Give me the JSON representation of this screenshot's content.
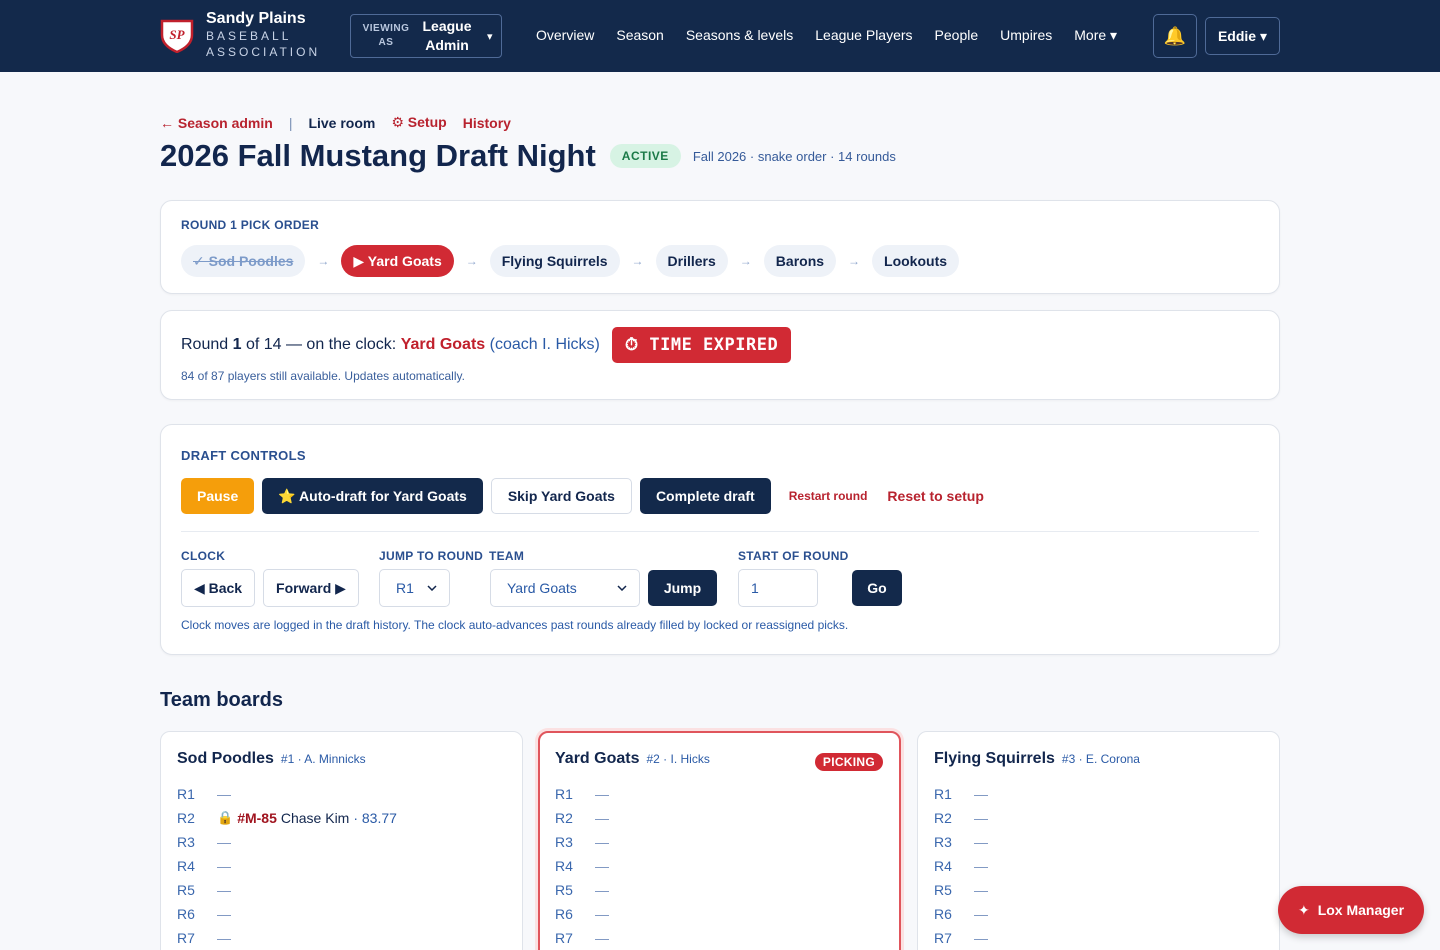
{
  "brand": {
    "logo": "SP",
    "name": "Sandy Plains",
    "sub1": "BASEBALL",
    "sub2": "ASSOCIATION"
  },
  "viewing": {
    "label_top": "VIEWING",
    "label_bottom": "AS",
    "role_1": "League",
    "role_2": "Admin",
    "caret": "▾"
  },
  "nav": [
    "Overview",
    "Season",
    "Seasons & levels",
    "League Players",
    "People",
    "Umpires",
    "More ▾"
  ],
  "bell_icon": "🔔",
  "user": "Eddie ▾",
  "breadcrumb": {
    "back": "← Season admin",
    "sep": "|",
    "live": "Live room",
    "setup": "⚙ Setup",
    "history": "History"
  },
  "page": {
    "title": "2026 Fall Mustang Draft Night",
    "status": "ACTIVE",
    "subtitle": "Fall 2026 · snake order · 14 rounds"
  },
  "pick_order": {
    "label": "ROUND 1 PICK ORDER",
    "arrow": "→",
    "teams": [
      {
        "label": "✓ Sod Poodles",
        "state": "done"
      },
      {
        "label": "▶ Yard Goats",
        "state": "current"
      },
      {
        "label": "Flying Squirrels",
        "state": "upcoming"
      },
      {
        "label": "Drillers",
        "state": "upcoming"
      },
      {
        "label": "Barons",
        "state": "upcoming"
      },
      {
        "label": "Lookouts",
        "state": "upcoming"
      }
    ]
  },
  "clock": {
    "prefix": "Round ",
    "round": "1",
    "mid": " of 14 — on the clock: ",
    "team": "Yard Goats",
    "coach": " (coach I. Hicks)",
    "expired": "⏱ TIME EXPIRED",
    "availability": "84 of 87 players still available. Updates automatically."
  },
  "controls": {
    "label": "DRAFT CONTROLS",
    "pause": "Pause",
    "autodraft": "⭐ Auto-draft for Yard Goats",
    "skip": "Skip Yard Goats",
    "complete": "Complete draft",
    "restart": "Restart round",
    "reset": "Reset to setup",
    "clock_label": "CLOCK",
    "back": "◀ Back",
    "forward": "Forward ▶",
    "jump_round_label": "JUMP TO ROUND",
    "jump_round_value": "R1",
    "team_label": "TEAM",
    "team_value": "Yard Goats",
    "jump": "Jump",
    "start_label": "START OF ROUND",
    "start_value": "1",
    "go": "Go",
    "note": "Clock moves are logged in the draft history. The clock auto-advances past rounds already filled by locked or reassigned picks."
  },
  "boards_title": "Team boards",
  "boards": [
    {
      "name": "Sod Poodles",
      "meta": "#1 · A. Minnicks",
      "picking": false,
      "rows": [
        {
          "r": "R1",
          "dash": "—"
        },
        {
          "r": "R2",
          "lock": "🔒",
          "pid": "#M-85",
          "player": "Chase Kim",
          "score": "· 83.77"
        },
        {
          "r": "R3",
          "dash": "—"
        },
        {
          "r": "R4",
          "dash": "—"
        },
        {
          "r": "R5",
          "dash": "—"
        },
        {
          "r": "R6",
          "dash": "—"
        },
        {
          "r": "R7",
          "dash": "—"
        }
      ]
    },
    {
      "name": "Yard Goats",
      "meta": "#2 · I. Hicks",
      "picking": true,
      "badge": "PICKING",
      "rows": [
        {
          "r": "R1",
          "dash": "—"
        },
        {
          "r": "R2",
          "dash": "—"
        },
        {
          "r": "R3",
          "dash": "—"
        },
        {
          "r": "R4",
          "dash": "—"
        },
        {
          "r": "R5",
          "dash": "—"
        },
        {
          "r": "R6",
          "dash": "—"
        },
        {
          "r": "R7",
          "dash": "—"
        }
      ]
    },
    {
      "name": "Flying Squirrels",
      "meta": "#3 · E. Corona",
      "picking": false,
      "rows": [
        {
          "r": "R1",
          "dash": "—"
        },
        {
          "r": "R2",
          "dash": "—"
        },
        {
          "r": "R3",
          "dash": "—"
        },
        {
          "r": "R4",
          "dash": "—"
        },
        {
          "r": "R5",
          "dash": "—"
        },
        {
          "r": "R6",
          "dash": "—"
        },
        {
          "r": "R7",
          "dash": "—"
        }
      ]
    }
  ],
  "assistant": {
    "icon": "✦",
    "label": "Lox Manager"
  },
  "colors": {
    "navy": "#13294b",
    "red": "#d12a34",
    "orange": "#f59e0b",
    "active_green": "#1b7a48"
  }
}
